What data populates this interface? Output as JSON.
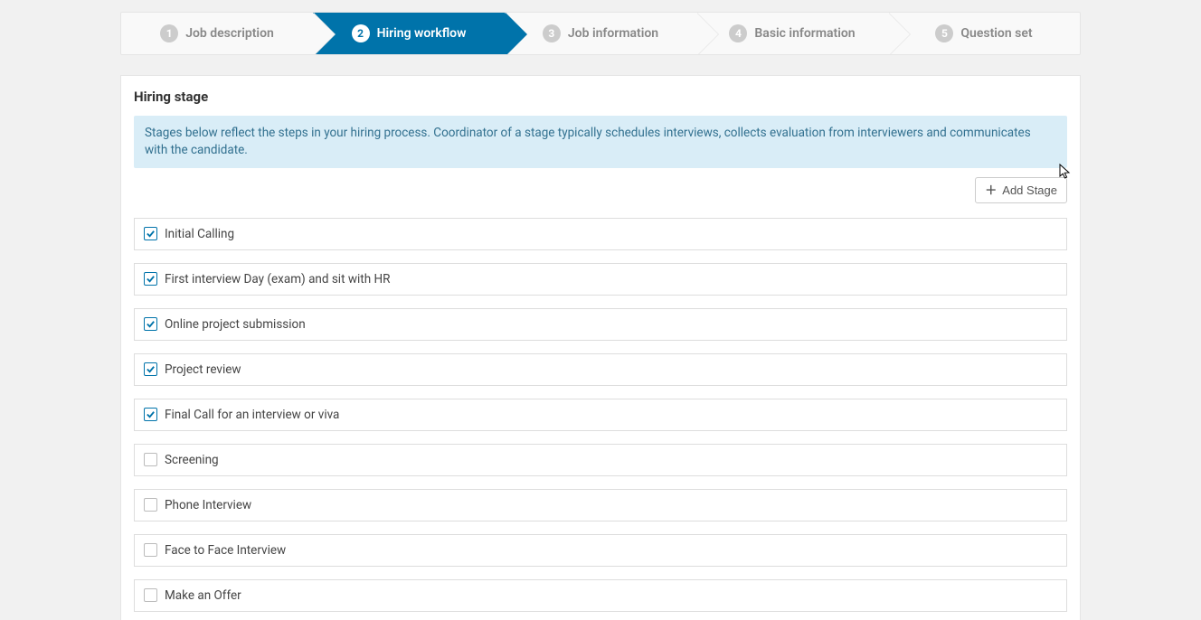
{
  "steps": [
    {
      "num": "1",
      "label": "Job description",
      "active": false
    },
    {
      "num": "2",
      "label": "Hiring workflow",
      "active": true
    },
    {
      "num": "3",
      "label": "Job information",
      "active": false
    },
    {
      "num": "4",
      "label": "Basic information",
      "active": false
    },
    {
      "num": "5",
      "label": "Question set",
      "active": false
    }
  ],
  "panel": {
    "title": "Hiring stage",
    "info": "Stages below reflect the steps in your hiring process. Coordinator of a stage typically schedules interviews, collects evaluation from interviewers and communicates with the candidate.",
    "add_button": "Add Stage"
  },
  "stages": [
    {
      "label": "Initial Calling",
      "checked": true
    },
    {
      "label": "First interview Day (exam) and sit with HR",
      "checked": true
    },
    {
      "label": "Online project submission",
      "checked": true
    },
    {
      "label": "Project review",
      "checked": true
    },
    {
      "label": "Final Call for an interview or viva",
      "checked": true
    },
    {
      "label": "Screening",
      "checked": false
    },
    {
      "label": "Phone Interview",
      "checked": false
    },
    {
      "label": "Face to Face Interview",
      "checked": false
    },
    {
      "label": "Make an Offer",
      "checked": false
    }
  ]
}
